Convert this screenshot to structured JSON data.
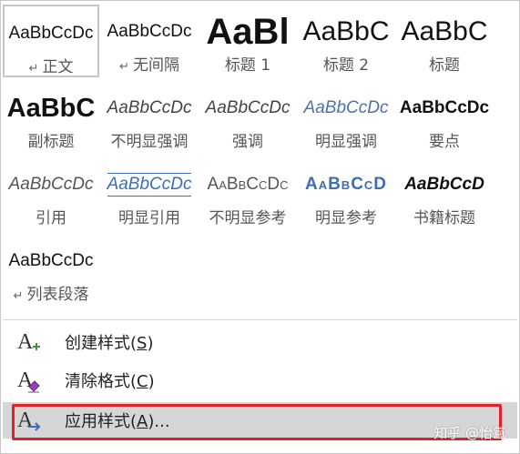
{
  "styles": [
    {
      "preview": "AaBbCcDc",
      "label": "正文",
      "para": "↵",
      "cls": "pv-normal",
      "selected": true
    },
    {
      "preview": "AaBbCcDc",
      "label": "无间隔",
      "para": "↵",
      "cls": "pv-normal",
      "selected": false
    },
    {
      "preview": "AaBl",
      "label": "标题 1",
      "para": "",
      "cls": "pv-h1",
      "selected": false
    },
    {
      "preview": "AaBbC",
      "label": "标题 2",
      "para": "",
      "cls": "pv-h2",
      "selected": false
    },
    {
      "preview": "AaBbC",
      "label": "标题",
      "para": "",
      "cls": "pv-title",
      "selected": false
    },
    {
      "preview": "AaBbC",
      "label": "副标题",
      "para": "",
      "cls": "pv-subtitle",
      "selected": false
    },
    {
      "preview": "AaBbCcDc",
      "label": "不明显强调",
      "para": "",
      "cls": "pv-italic",
      "selected": false
    },
    {
      "preview": "AaBbCcDc",
      "label": "强调",
      "para": "",
      "cls": "pv-italic",
      "selected": false
    },
    {
      "preview": "AaBbCcDc",
      "label": "明显强调",
      "para": "",
      "cls": "pv-ital-blue",
      "selected": false
    },
    {
      "preview": "AaBbCcDc",
      "label": "要点",
      "para": "",
      "cls": "pv-strong",
      "selected": false
    },
    {
      "preview": "AaBbCcDc",
      "label": "引用",
      "para": "",
      "cls": "pv-quote",
      "selected": false
    },
    {
      "preview": "AaBbCcDc",
      "label": "明显引用",
      "para": "",
      "cls": "pv-intense-quote",
      "selected": false
    },
    {
      "preview": "AaBbCcDc",
      "label": "不明显参考",
      "para": "",
      "cls": "pv-subtle-ref",
      "selected": false
    },
    {
      "preview": "AaBbCcD",
      "label": "明显参考",
      "para": "",
      "cls": "pv-intense-ref",
      "selected": false
    },
    {
      "preview": "AaBbCcD",
      "label": "书籍标题",
      "para": "",
      "cls": "pv-book",
      "selected": false
    },
    {
      "preview": "AaBbCcDc",
      "label": "列表段落",
      "para": "↵",
      "cls": "pv-normal",
      "selected": false
    }
  ],
  "menu": {
    "create": {
      "text": "创建样式(",
      "key": "S",
      "end": ")",
      "icon": "create-style-icon"
    },
    "clear": {
      "text": "清除格式(",
      "key": "C",
      "end": ")",
      "icon": "clear-format-icon"
    },
    "apply": {
      "text": "应用样式(",
      "key": "A",
      "end": ")...",
      "icon": "apply-style-icon"
    }
  },
  "watermark": "知乎 @怡氲",
  "colors": {
    "highlight": "#d6d6d6",
    "red_box": "#e0202a",
    "accent_blue": "#3d6db5",
    "green": "#3a9a3a",
    "purple": "#9b3fb5"
  }
}
